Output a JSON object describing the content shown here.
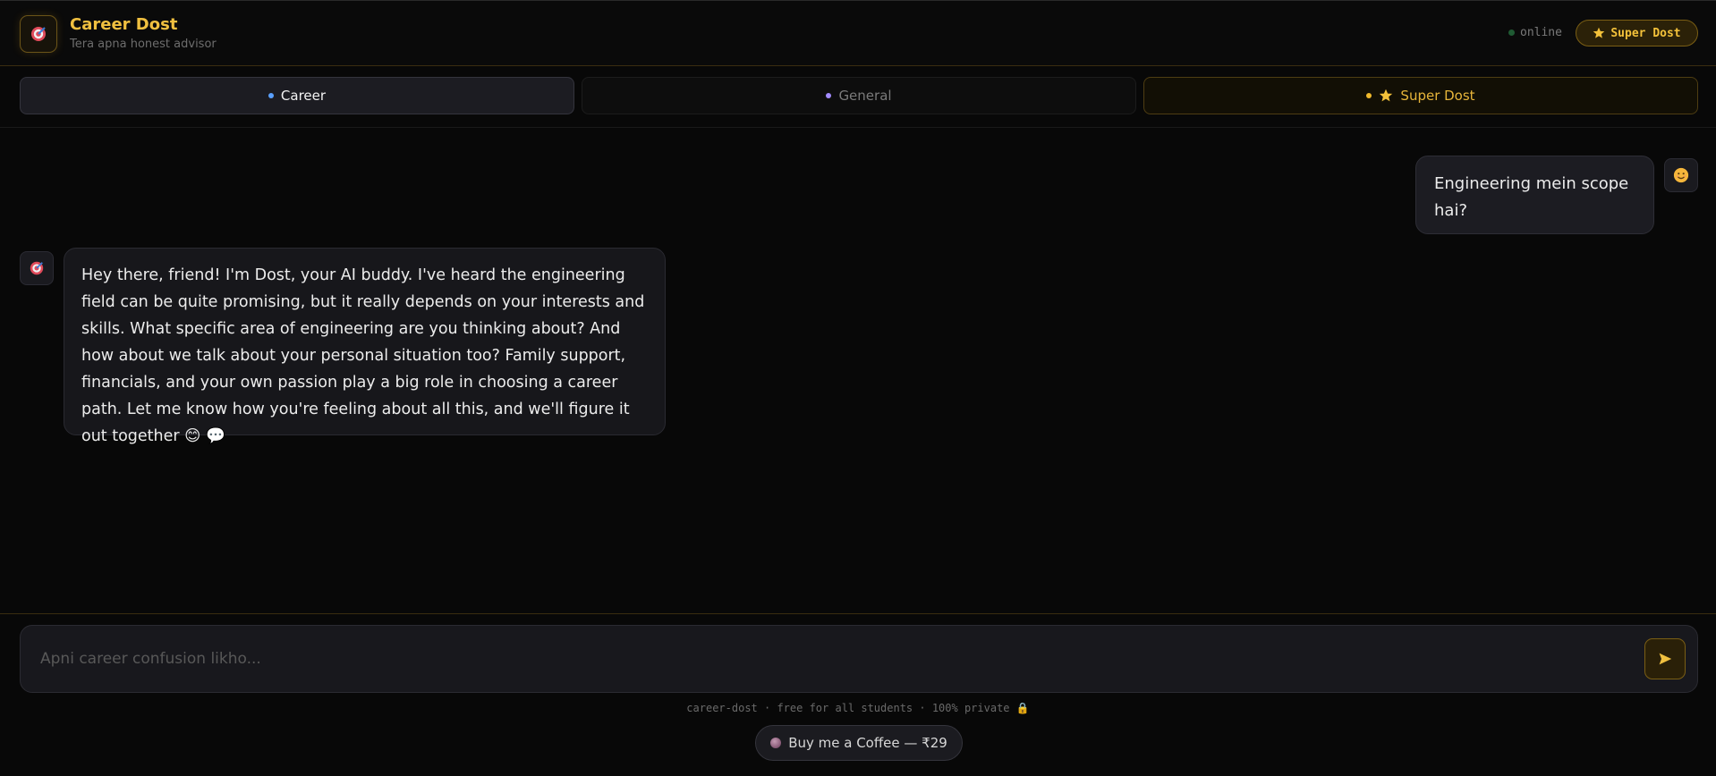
{
  "header": {
    "title": "Career Dost",
    "subtitle": "Tera apna honest advisor",
    "status_text": "online",
    "super_button_label": "Super Dost"
  },
  "tabs": [
    {
      "label": "Career",
      "active": true
    },
    {
      "label": "General",
      "active": false
    },
    {
      "label": "Super Dost",
      "active": false
    }
  ],
  "messages": {
    "user_1": "Engineering mein scope hai?",
    "bot_1": "Hey there, friend! I'm Dost, your AI buddy. I've heard the engineering field can be quite promising, but it really depends on your interests and skills. What specific area of engineering are you thinking about? And how about we talk about your personal situation too? Family support, financials, and your own passion play a big role in choosing a career path. Let me know how you're feeling about all this, and we'll figure it out together 😊 💬"
  },
  "composer": {
    "placeholder": "Apni career confusion likho...",
    "value": ""
  },
  "footer": {
    "text": "career-dost · free for all students · 100% private 🔒",
    "coffee_label": "Buy me a Coffee — ₹29"
  },
  "colors": {
    "accent": "#f0c040",
    "background": "#080808",
    "career_dot": "#5aa0ff",
    "general_dot": "#a28bff",
    "super_dot": "#f0b92c"
  },
  "icons": {
    "logo": "target-icon",
    "user_avatar": "smiling-face-icon",
    "bot_avatar": "target-icon",
    "send": "send-arrow-icon",
    "star": "star-icon",
    "coffee": "coffee-icon"
  }
}
